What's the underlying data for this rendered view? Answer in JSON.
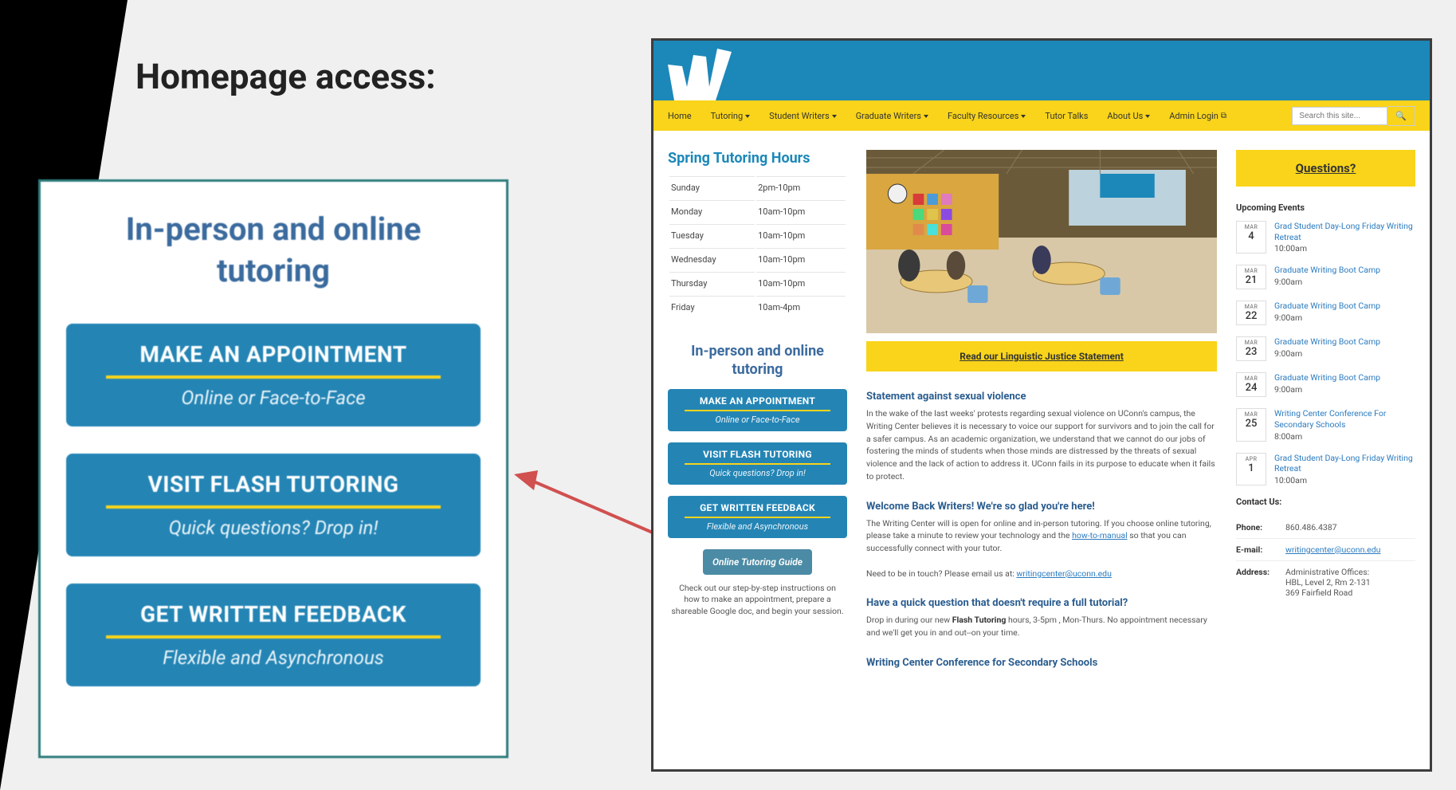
{
  "slide_title": "Homepage access:",
  "zoom": {
    "heading": "In-person and online tutoring",
    "buttons": [
      {
        "top": "MAKE AN APPOINTMENT",
        "sub": "Online or Face-to-Face"
      },
      {
        "top": "VISIT FLASH TUTORING",
        "sub": "Quick questions? Drop in!"
      },
      {
        "top": "GET WRITTEN FEEDBACK",
        "sub": "Flexible and Asynchronous"
      }
    ]
  },
  "nav": {
    "items": [
      "Home",
      "Tutoring",
      "Student Writers",
      "Graduate Writers",
      "Faculty Resources",
      "Tutor Talks",
      "About Us",
      "Admin Login"
    ],
    "search_placeholder": "Search this site..."
  },
  "hours": {
    "title": "Spring Tutoring Hours",
    "rows": [
      {
        "day": "Sunday",
        "time": "2pm-10pm"
      },
      {
        "day": "Monday",
        "time": "10am-10pm"
      },
      {
        "day": "Tuesday",
        "time": "10am-10pm"
      },
      {
        "day": "Wednesday",
        "time": "10am-10pm"
      },
      {
        "day": "Thursday",
        "time": "10am-10pm"
      },
      {
        "day": "Friday",
        "time": "10am-4pm"
      }
    ]
  },
  "tutoring_heading": "In-person and online tutoring",
  "small_buttons": [
    {
      "top": "MAKE AN APPOINTMENT",
      "sub": "Online or Face-to-Face"
    },
    {
      "top": "VISIT FLASH TUTORING",
      "sub": "Quick questions? Drop in!"
    },
    {
      "top": "GET WRITTEN FEEDBACK",
      "sub": "Flexible and Asynchronous"
    }
  ],
  "guide_button": "Online Tutoring Guide",
  "guide_caption": "Check out our step-by-step instructions on how to make an appointment, prepare a shareable Google doc, and begin your session.",
  "banners": {
    "linguistic": "Read our Linguistic Justice Statement",
    "questions": "Questions?"
  },
  "articles": {
    "a1_title": "Statement against sexual violence",
    "a1_body": "In the wake of the last weeks' protests regarding sexual violence on UConn's campus, the Writing Center believes it is necessary to voice our support for survivors and to join the call for a safer campus. As an academic organization, we understand that we cannot do our jobs of fostering the minds of students when those minds are distressed by the threats of sexual violence and the lack of action to address it. UConn fails in its purpose to educate when it fails to protect.",
    "a2_title": "Welcome Back Writers! We're so glad you're here!",
    "a2_body_pre": "The Writing Center will is open for  online and in-person tutoring.  If you choose online tutoring, please take a minute to review your technology and  the ",
    "a2_link": "how-to-manual",
    "a2_body_post": " so that you can successfully connect with your tutor.",
    "a2_email_lead": "Need to be in touch? Please email us at: ",
    "a2_email": "writingcenter@uconn.edu",
    "a3_title": "Have a quick question that doesn't require a full tutorial?",
    "a3_body_pre": "Drop in during our new ",
    "a3_body_strong": "Flash Tutoring",
    "a3_body_post": " hours, 3-5pm , Mon-Thurs. No appointment necessary and we'll get you in and out--on your time.",
    "a4_title": "Writing Center Conference for Secondary Schools"
  },
  "events_heading": "Upcoming Events",
  "events": [
    {
      "month": "MAR",
      "day": "4",
      "title": "Grad Student Day-Long Friday Writing Retreat",
      "time": "10:00am"
    },
    {
      "month": "MAR",
      "day": "21",
      "title": "Graduate Writing Boot Camp",
      "time": "9:00am"
    },
    {
      "month": "MAR",
      "day": "22",
      "title": "Graduate Writing Boot Camp",
      "time": "9:00am"
    },
    {
      "month": "MAR",
      "day": "23",
      "title": "Graduate Writing Boot Camp",
      "time": "9:00am"
    },
    {
      "month": "MAR",
      "day": "24",
      "title": "Graduate Writing Boot Camp",
      "time": "9:00am"
    },
    {
      "month": "MAR",
      "day": "25",
      "title": "Writing Center Conference For Secondary Schools",
      "time": "8:00am"
    },
    {
      "month": "APR",
      "day": "1",
      "title": "Grad Student Day-Long Friday Writing Retreat",
      "time": "10:00am"
    }
  ],
  "contact": {
    "heading": "Contact Us:",
    "phone_lbl": "Phone:",
    "phone_val": "860.486.4387",
    "email_lbl": "E-mail:",
    "email_val": "writingcenter@uconn.edu",
    "addr_lbl": "Address:",
    "addr_line1": "Administrative Offices:",
    "addr_line2": "HBL, Level 2, Rm 2-131",
    "addr_line3": "369 Fairfield Road"
  }
}
